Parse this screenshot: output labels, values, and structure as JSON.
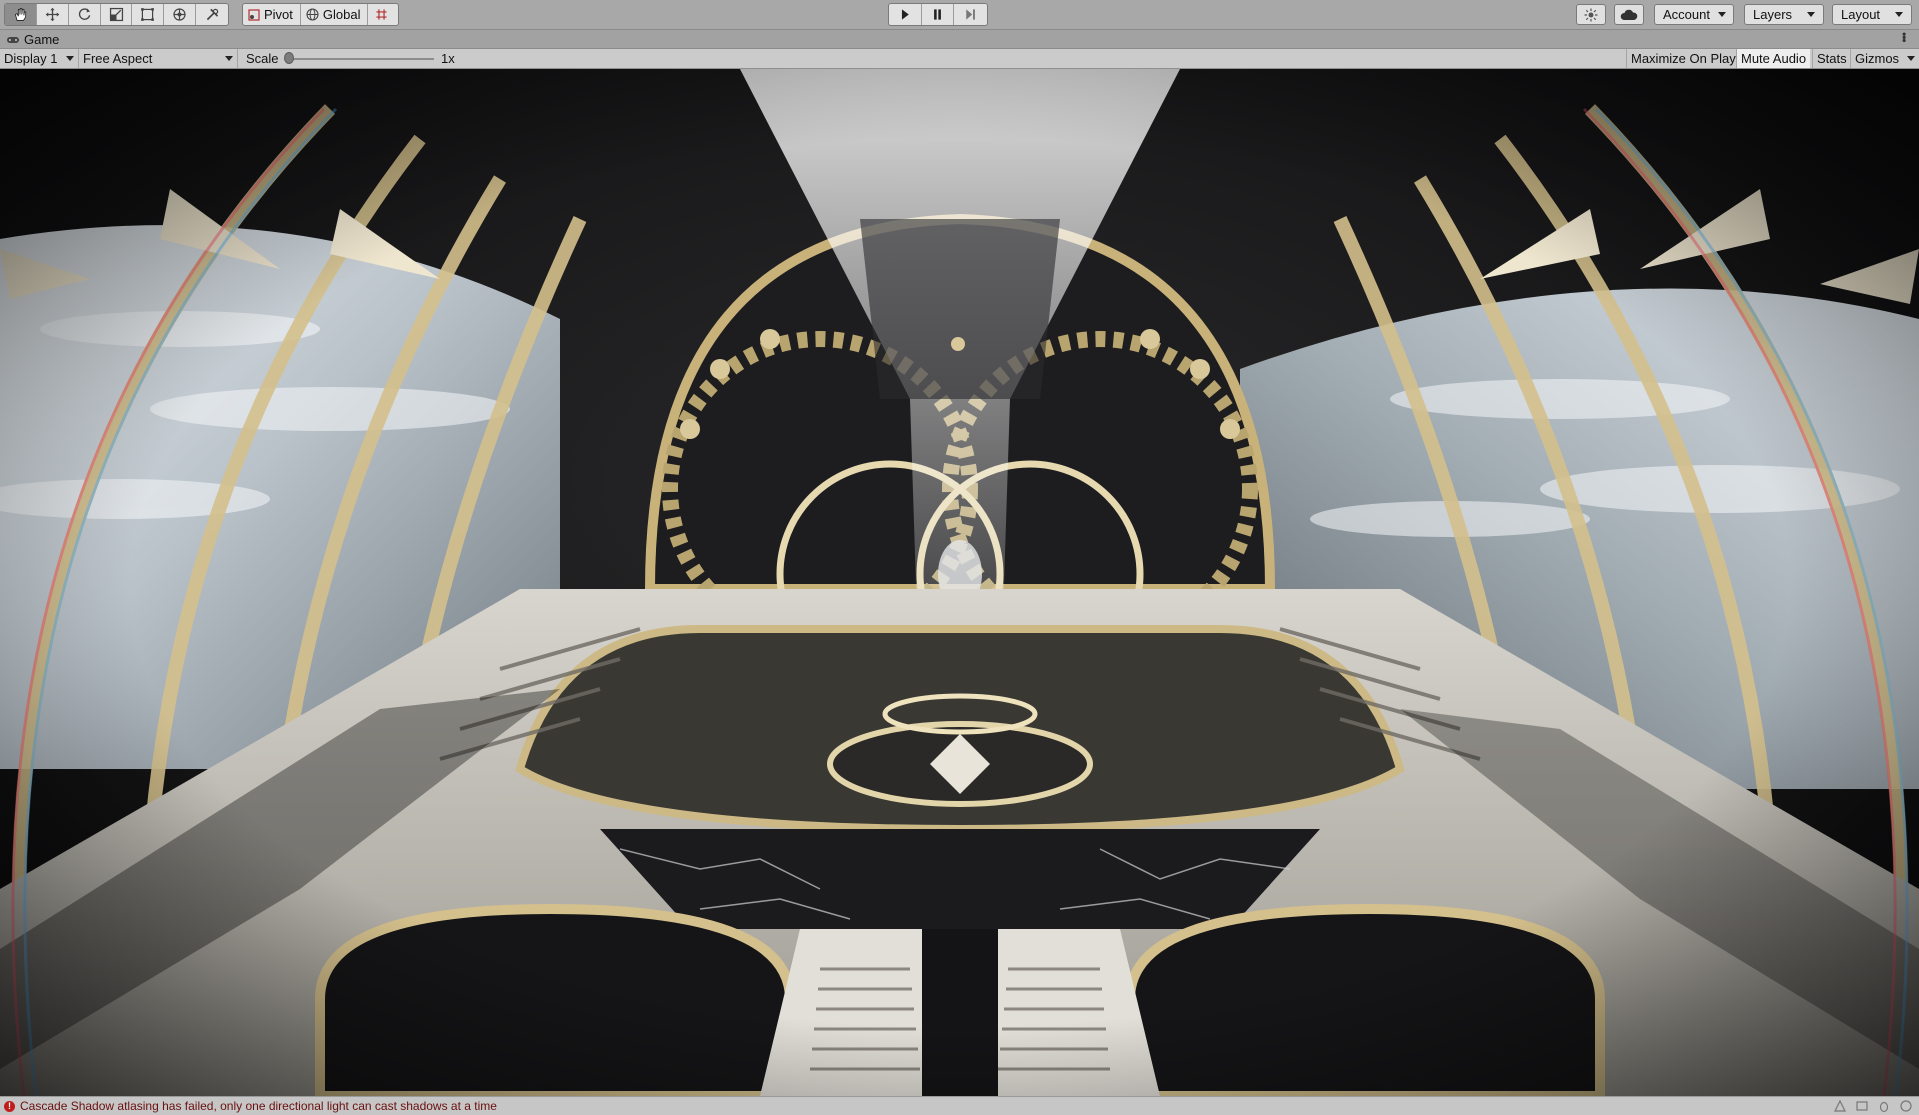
{
  "toolbar": {
    "transform_tools": [
      "hand-tool",
      "move-tool",
      "rotate-tool",
      "scale-tool",
      "rect-tool",
      "transform-tool",
      "custom-tool"
    ],
    "pivot_label": "Pivot",
    "global_label": "Global",
    "play_controls": [
      "play",
      "pause",
      "step"
    ],
    "account_label": "Account",
    "layers_label": "Layers",
    "layout_label": "Layout"
  },
  "tab": {
    "title": "Game"
  },
  "game_toolbar": {
    "display_label": "Display 1",
    "aspect_label": "Free Aspect",
    "scale_label": "Scale",
    "scale_value": "1x",
    "scale_fraction": 0.0,
    "maximize_label": "Maximize On Play",
    "mute_label": "Mute Audio",
    "mute_active": true,
    "stats_label": "Stats",
    "gizmos_label": "Gizmos"
  },
  "status": {
    "message": "Cascade Shadow atlasing has failed, only one directional light can cast shadows at a time",
    "level": "error"
  },
  "colors": {
    "gold": "#c9b27a",
    "sky": "#dbe3ea",
    "space": "#0a0a0c",
    "marble": "#1c1c1e"
  }
}
